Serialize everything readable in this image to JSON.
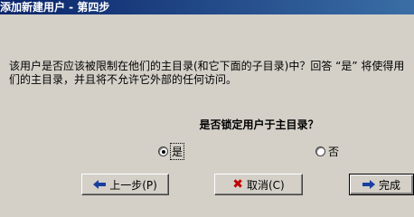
{
  "window": {
    "title": "添加新建用户 - 第四步"
  },
  "description": {
    "line1": "该用户是否应该被限制在他们的主目录(和它下面的子目录)中？回答 “是” 将使得用",
    "line2": "们的主目录，并且将不允许它外部的任何访问。"
  },
  "question": "是否锁定用户于主目录？",
  "options": [
    {
      "label": "是",
      "checked": true
    },
    {
      "label": "否",
      "checked": false
    }
  ],
  "buttons": {
    "back": "上一步(P)",
    "cancel": "取消(C)",
    "finish": "完成"
  },
  "colors": {
    "background": "#d4d0c8",
    "title_bar": "#0a246a",
    "arrow": "#1a3fa0",
    "cancel_icon": "#c00000"
  }
}
